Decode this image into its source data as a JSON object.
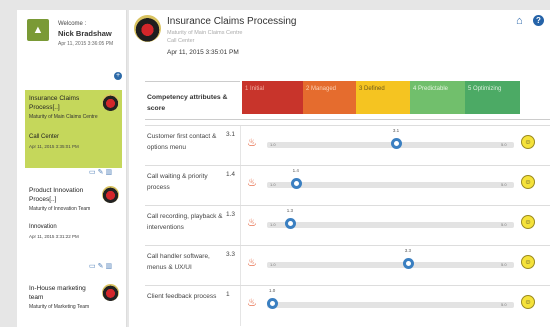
{
  "sidebar": {
    "user": {
      "welcome": "Welcome :",
      "name": "Nick Bradshaw",
      "date": "Apr 11, 2015 3:36:05 PM"
    },
    "add_icon": "plus-icon",
    "cards": [
      {
        "title": "Insurance Claims Process[..]",
        "subtitle": "Maturity of Main Claims Centre",
        "team": "Call Center",
        "date": "Apr 11, 2015 3:35:01 PM",
        "active": true
      },
      {
        "title": "Product Innovation Proces[..]",
        "subtitle": "Maturity of Innovation Team",
        "team": "Innovation",
        "date": "Apr 11, 2015 3:31:22 PM",
        "active": false
      },
      {
        "title": "In-House marketing team",
        "subtitle": "Maturity of Marketing Team",
        "team": "",
        "date": "",
        "active": false
      }
    ]
  },
  "header": {
    "title": "Insurance Claims Processing",
    "subtitle1": "Maturity of Main Claims Centre",
    "subtitle2": "Call Center",
    "date": "Apr 11, 2015 3:35:01 PM"
  },
  "table": {
    "competency_header": "Competency attributes & score",
    "levels": [
      "1 Initial",
      "2 Managed",
      "3 Defined",
      "4 Predictable",
      "5 Optimizing"
    ],
    "level_colors": [
      "#c8342b",
      "#e56c2e",
      "#f5c421",
      "#71bf6c",
      "#4caa65"
    ],
    "scale_min": "1.0",
    "scale_max": "5.0",
    "rows": [
      {
        "label": "Customer first contact & options menu",
        "score": "3.1",
        "value": 3.1,
        "value_label": "3.1"
      },
      {
        "label": "Call waiting & priority process",
        "score": "1.4",
        "value": 1.4,
        "value_label": "1.4"
      },
      {
        "label": "Call recording, playback & interventions",
        "score": "1.3",
        "value": 1.3,
        "value_label": "1.3"
      },
      {
        "label": "Call handler software, menus & UX/UI",
        "score": "3.3",
        "value": 3.3,
        "value_label": "3.3"
      },
      {
        "label": "Client feedback process",
        "score": "1",
        "value": 1.0,
        "value_label": "1.0"
      }
    ]
  },
  "colors": {
    "accent": "#2563a8",
    "active_card": "#c5d75b",
    "knob": "#3a7fc1"
  }
}
